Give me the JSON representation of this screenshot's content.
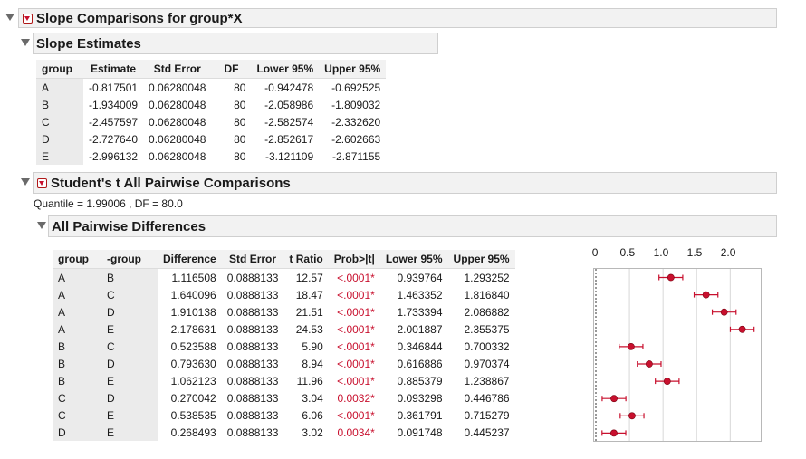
{
  "header": {
    "title": "Slope Comparisons for group*X"
  },
  "slope_estimates": {
    "title": "Slope Estimates",
    "columns": [
      "group",
      "Estimate",
      "Std Error",
      "DF",
      "Lower 95%",
      "Upper 95%"
    ],
    "rows": [
      [
        "A",
        "-0.817501",
        "0.06280048",
        "80",
        "-0.942478",
        "-0.692525"
      ],
      [
        "B",
        "-1.934009",
        "0.06280048",
        "80",
        "-2.058986",
        "-1.809032"
      ],
      [
        "C",
        "-2.457597",
        "0.06280048",
        "80",
        "-2.582574",
        "-2.332620"
      ],
      [
        "D",
        "-2.727640",
        "0.06280048",
        "80",
        "-2.852617",
        "-2.602663"
      ],
      [
        "E",
        "-2.996132",
        "0.06280048",
        "80",
        "-3.121109",
        "-2.871155"
      ]
    ]
  },
  "students_t": {
    "title": "Student's t All Pairwise Comparisons",
    "quantile_text": "Quantile = 1.99006 , DF = 80.0"
  },
  "pairwise": {
    "title": "All Pairwise Differences",
    "columns": [
      "group",
      "-group",
      "Difference",
      "Std Error",
      "t Ratio",
      "Prob>|t|",
      "Lower 95%",
      "Upper 95%"
    ],
    "rows": [
      [
        "A",
        "B",
        "1.116508",
        "0.0888133",
        "12.57",
        "<.0001*",
        "0.939764",
        "1.293252"
      ],
      [
        "A",
        "C",
        "1.640096",
        "0.0888133",
        "18.47",
        "<.0001*",
        "1.463352",
        "1.816840"
      ],
      [
        "A",
        "D",
        "1.910138",
        "0.0888133",
        "21.51",
        "<.0001*",
        "1.733394",
        "2.086882"
      ],
      [
        "A",
        "E",
        "2.178631",
        "0.0888133",
        "24.53",
        "<.0001*",
        "2.001887",
        "2.355375"
      ],
      [
        "B",
        "C",
        "0.523588",
        "0.0888133",
        "5.90",
        "<.0001*",
        "0.346844",
        "0.700332"
      ],
      [
        "B",
        "D",
        "0.793630",
        "0.0888133",
        "8.94",
        "<.0001*",
        "0.616886",
        "0.970374"
      ],
      [
        "B",
        "E",
        "1.062123",
        "0.0888133",
        "11.96",
        "<.0001*",
        "0.885379",
        "1.238867"
      ],
      [
        "C",
        "D",
        "0.270042",
        "0.0888133",
        "3.04",
        "0.0032*",
        "0.093298",
        "0.446786"
      ],
      [
        "C",
        "E",
        "0.538535",
        "0.0888133",
        "6.06",
        "<.0001*",
        "0.361791",
        "0.715279"
      ],
      [
        "D",
        "E",
        "0.268493",
        "0.0888133",
        "3.02",
        "0.0034*",
        "0.091748",
        "0.445237"
      ]
    ]
  },
  "chart_data": {
    "type": "scatter",
    "xlim": [
      0,
      2.4
    ],
    "x_ticks": [
      "0",
      "0.5",
      "1.0",
      "1.5",
      "2.0"
    ],
    "x_tick_values": [
      0,
      0.5,
      1.0,
      1.5,
      2.0
    ],
    "grid": true,
    "points": [
      1.116508,
      1.640096,
      1.910138,
      2.178631,
      0.523588,
      0.79363,
      1.062123,
      0.270042,
      0.538535,
      0.268493
    ],
    "lower": [
      0.939764,
      1.463352,
      1.733394,
      2.001887,
      0.346844,
      0.616886,
      0.885379,
      0.093298,
      0.361791,
      0.091748
    ],
    "upper": [
      1.293252,
      1.81684,
      2.086882,
      2.355375,
      0.700332,
      0.970374,
      1.238867,
      0.446786,
      0.715279,
      0.445237
    ]
  },
  "colors": {
    "point": "#c8102e",
    "accent": "#c8102e",
    "header_bg": "#f2f2f2",
    "grid": "#d8d8d8"
  }
}
